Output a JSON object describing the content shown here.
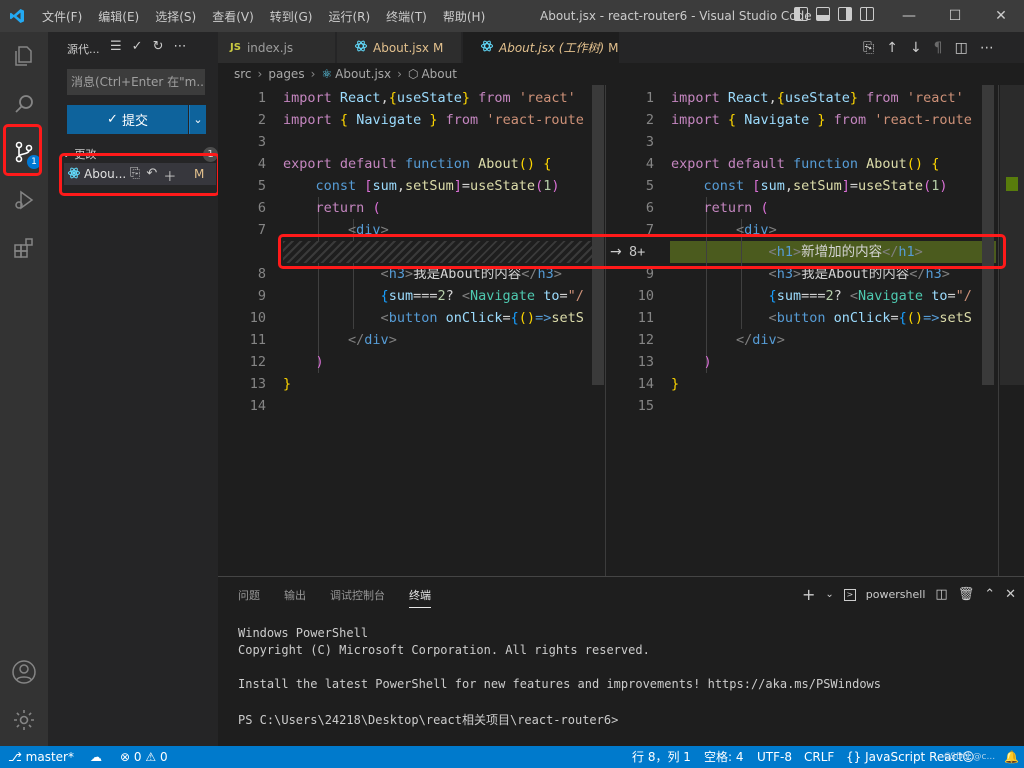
{
  "titlebar": {
    "menu": [
      "文件(F)",
      "编辑(E)",
      "选择(S)",
      "查看(V)",
      "转到(G)",
      "运行(R)",
      "终端(T)",
      "帮助(H)"
    ],
    "title": "About.jsx - react-router6 - Visual Studio Code"
  },
  "activitybar": {
    "icons": [
      "explorer-icon",
      "search-icon",
      "source-control-icon",
      "run-debug-icon",
      "extensions-icon",
      "account-icon",
      "settings-gear-icon"
    ],
    "scm_badge": "1"
  },
  "sidebar": {
    "title": "源代...",
    "commit_placeholder": "消息(Ctrl+Enter 在\"m...",
    "commit_label": "提交",
    "changes_label": "更改",
    "changes_count": "1",
    "file": {
      "name": "Abou...",
      "status": "M"
    }
  },
  "tabs": [
    {
      "prefix": "JS",
      "label": "index.js",
      "status": ""
    },
    {
      "prefix": "",
      "label": "About.jsx",
      "status": "M"
    },
    {
      "prefix": "",
      "label": "About.jsx (工作树)",
      "status": "M"
    }
  ],
  "breadcrumb": [
    "src",
    "pages",
    "About.jsx",
    "About"
  ],
  "editor": {
    "left_line_numbers": [
      "1",
      "2",
      "3",
      "4",
      "5",
      "6",
      "7",
      "",
      "8",
      "9",
      "10",
      "11",
      "12",
      "13",
      "14"
    ],
    "right_line_numbers": [
      "1",
      "2",
      "3",
      "4",
      "5",
      "6",
      "7",
      "8+",
      "9",
      "10",
      "11",
      "12",
      "13",
      "14",
      "15"
    ],
    "arrow": "→"
  },
  "panel": {
    "tabs": [
      "问题",
      "输出",
      "调试控制台",
      "终端"
    ],
    "active_tab": "终端",
    "shell": "powershell",
    "terminal_lines": [
      "Windows PowerShell",
      "Copyright (C) Microsoft Corporation. All rights reserved.",
      "",
      "Install the latest PowerShell for new features and improvements! https://aka.ms/PSWindows",
      "",
      "PS C:\\Users\\24218\\Desktop\\react相关项目\\react-router6>"
    ]
  },
  "statusbar": {
    "branch": "master*",
    "errors": "0",
    "warnings": "0",
    "position": "行 8，列 1",
    "spaces": "空格: 4",
    "encoding": "UTF-8",
    "eol": "CRLF",
    "language": "JavaScript React",
    "watermark": "CSDN @c...",
    "colors": {
      "bar": "#007acc",
      "highlight": "#ff1a1a",
      "added": "#4b5b1e"
    }
  }
}
